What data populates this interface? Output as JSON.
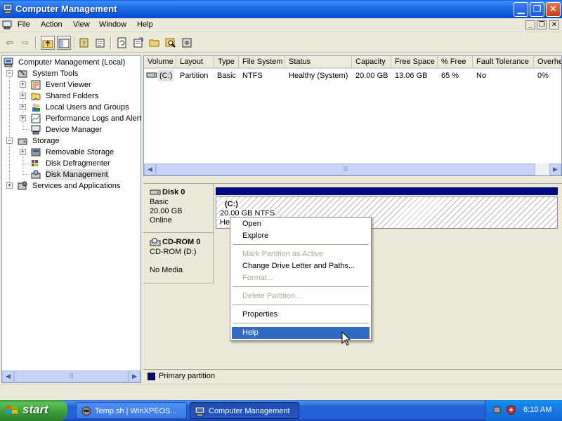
{
  "window": {
    "title": "Computer Management"
  },
  "menu": {
    "items": [
      "File",
      "Action",
      "View",
      "Window",
      "Help"
    ]
  },
  "tree": {
    "root": "Computer Management (Local)",
    "system_tools": "System Tools",
    "event_viewer": "Event Viewer",
    "shared_folders": "Shared Folders",
    "local_users": "Local Users and Groups",
    "perf_logs": "Performance Logs and Alerts",
    "device_manager": "Device Manager",
    "storage": "Storage",
    "removable_storage": "Removable Storage",
    "disk_defrag": "Disk Defragmenter",
    "disk_management": "Disk Management",
    "services_apps": "Services and Applications"
  },
  "volume_list": {
    "columns": [
      "Volume",
      "Layout",
      "Type",
      "File System",
      "Status",
      "Capacity",
      "Free Space",
      "% Free",
      "Fault Tolerance",
      "Overhe"
    ],
    "rows": [
      {
        "volume": "(C:)",
        "layout": "Partition",
        "type": "Basic",
        "fs": "NTFS",
        "status": "Healthy (System)",
        "capacity": "20.00 GB",
        "free": "13.06 GB",
        "pct_free": "65 %",
        "fault": "No",
        "overhead": "0%"
      }
    ]
  },
  "disks": {
    "disk0": {
      "name": "Disk 0",
      "type": "Basic",
      "size": "20.00 GB",
      "state": "Online"
    },
    "partition_c": {
      "label": "(C:)",
      "detail": "20.00 GB NTFS",
      "status_partial": "He"
    },
    "cdrom0": {
      "name": "CD-ROM 0",
      "drive": "CD-ROM (D:)",
      "media": "No Media"
    }
  },
  "legend": {
    "primary": "Primary partition"
  },
  "context_menu": {
    "open": "Open",
    "explore": "Explore",
    "mark_active": "Mark Partition as Active",
    "change_letter": "Change Drive Letter and Paths...",
    "format": "Format...",
    "delete": "Delete Partition...",
    "properties": "Properties",
    "help": "Help"
  },
  "taskbar": {
    "start": "start",
    "task1": "Temp.sh | WinXPEOS...",
    "task2": "Computer Management",
    "clock": "6:10 AM"
  },
  "colors": {
    "primary_partition": "#000a80",
    "menu_highlight": "#316ac5",
    "titlebar": "#0a53d8"
  }
}
